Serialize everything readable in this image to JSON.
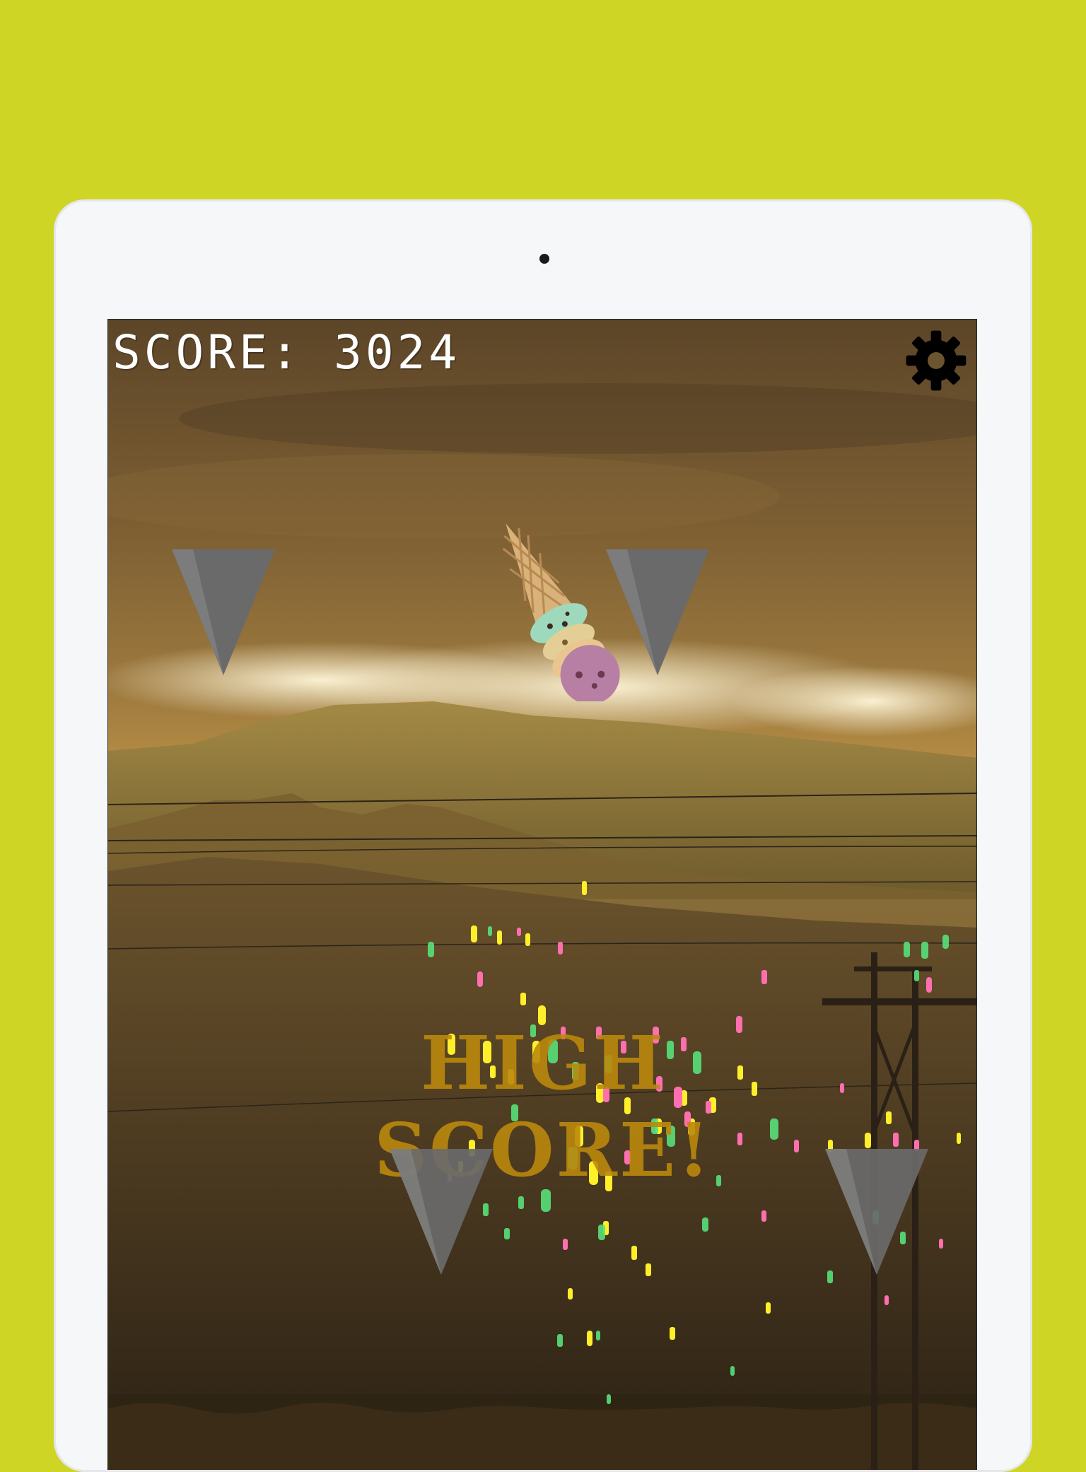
{
  "device": {
    "frame_color": "#f6f7f9",
    "background_color": "#cfd524"
  },
  "hud": {
    "score_label": "SCORE:",
    "score_value": "3024",
    "settings_icon": "gear-icon"
  },
  "banner": {
    "text": "HIGH SCORE!"
  },
  "spikes": [
    {
      "name": "spike-top-left",
      "icon": "triangle-down"
    },
    {
      "name": "spike-top-right",
      "icon": "triangle-down"
    },
    {
      "name": "spike-bottom-left",
      "icon": "triangle-down"
    },
    {
      "name": "spike-bottom-right",
      "icon": "triangle-down"
    }
  ],
  "player": {
    "sprite": "ice-cream-cone"
  },
  "colors": {
    "spike": "#6a6a6a",
    "banner": "#b8880c",
    "confetti": [
      "#ffef2a",
      "#58e07a",
      "#ff6fb0"
    ]
  }
}
